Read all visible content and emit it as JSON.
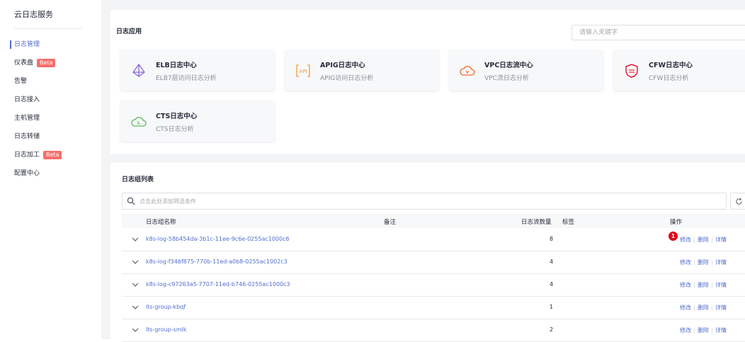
{
  "sidebar": {
    "title": "云日志服务",
    "items": [
      {
        "label": "日志管理",
        "active": true,
        "beta": ""
      },
      {
        "label": "仪表盘",
        "active": false,
        "beta": "Beta"
      },
      {
        "label": "告警",
        "active": false,
        "beta": ""
      },
      {
        "label": "日志接入",
        "active": false,
        "beta": ""
      },
      {
        "label": "主机管理",
        "active": false,
        "beta": ""
      },
      {
        "label": "日志转储",
        "active": false,
        "beta": ""
      },
      {
        "label": "日志加工",
        "active": false,
        "beta": "Beta"
      },
      {
        "label": "配置中心",
        "active": false,
        "beta": ""
      }
    ]
  },
  "apps": {
    "title": "日志应用",
    "search_placeholder": "请输入关键字",
    "cards": [
      {
        "title": "ELB日志中心",
        "subtitle": "ELB7层访问日志分析",
        "icon": "elb-icon"
      },
      {
        "title": "APIG日志中心",
        "subtitle": "APIG访问日志分析",
        "icon": "apig-icon"
      },
      {
        "title": "VPC日志流中心",
        "subtitle": "VPC流日志分析",
        "icon": "vpc-icon"
      },
      {
        "title": "CFW日志中心",
        "subtitle": "CFW日志分析",
        "icon": "cfw-icon"
      },
      {
        "title": "CTS日志中心",
        "subtitle": "CTS日志分析",
        "icon": "cts-icon"
      }
    ]
  },
  "groups": {
    "title": "日志组列表",
    "filter_placeholder": "点击此处添加筛选条件",
    "columns": {
      "name": "日志组名称",
      "remark": "备注",
      "count": "日志流数量",
      "tags": "标签",
      "ops": "操作"
    },
    "rows": [
      {
        "name": "k8s-log-58b454da-3b1c-11ee-9c6e-0255ac1000c6",
        "count": "8"
      },
      {
        "name": "k8s-log-f346f875-770b-11ed-a0b8-0255ac1002c3",
        "count": "4"
      },
      {
        "name": "k8s-log-c97263a5-7707-11ed-b746-0255ac1000c3",
        "count": "4"
      },
      {
        "name": "lts-group-kbqf",
        "count": "1"
      },
      {
        "name": "lts-group-smlk",
        "count": "2"
      }
    ],
    "actions": {
      "edit": "修改",
      "delete": "删除",
      "detail": "详情"
    },
    "badge": "1"
  },
  "colors": {
    "accent": "#526ecc",
    "beta": "#f66f6a",
    "badge": "#e0001b"
  }
}
